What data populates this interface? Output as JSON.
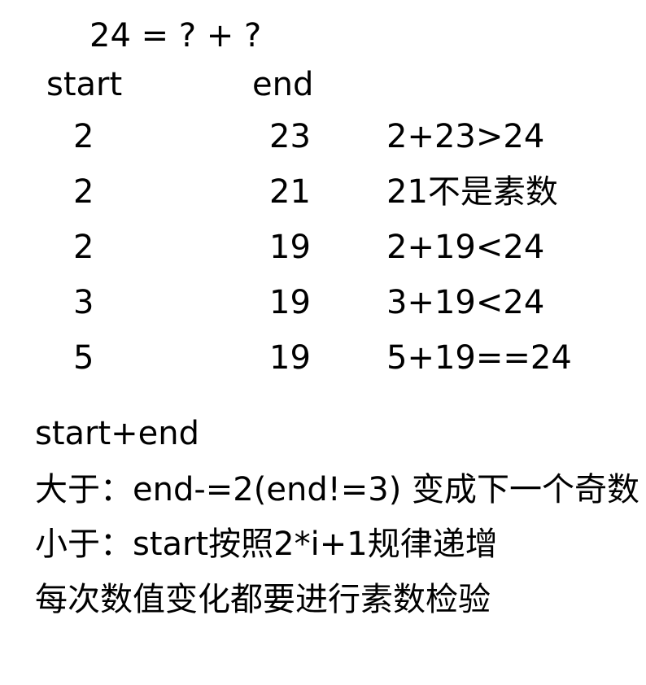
{
  "title": "24 = ? + ?",
  "headers": {
    "start": "start",
    "end": "end"
  },
  "rows": [
    {
      "start": "2",
      "end": "23",
      "note": "2+23>24"
    },
    {
      "start": "2",
      "end": "21",
      "note": "21不是素数"
    },
    {
      "start": "2",
      "end": "19",
      "note": "2+19<24"
    },
    {
      "start": "3",
      "end": "19",
      "note": "3+19<24"
    },
    {
      "start": "5",
      "end": "19",
      "note": "5+19==24"
    }
  ],
  "notes": [
    "start+end",
    "大于：end-=2(end!=3) 变成下一个奇数",
    "小于：start按照2*i+1规律递增",
    "每次数值变化都要进行素数检验"
  ]
}
